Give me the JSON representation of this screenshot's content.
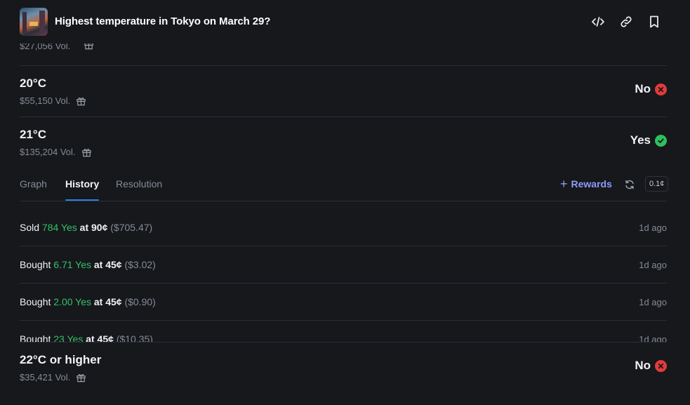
{
  "header": {
    "title": "Highest temperature in Tokyo on March 29?",
    "icons": [
      "code-icon",
      "link-icon",
      "bookmark-icon"
    ]
  },
  "partial_row": {
    "volume": "$27,056 Vol."
  },
  "outcomes": [
    {
      "label": "20°C",
      "volume": "$55,150 Vol.",
      "result": "No"
    },
    {
      "label": "21°C",
      "volume": "$135,204 Vol.",
      "result": "Yes"
    }
  ],
  "tabs": {
    "items": [
      {
        "label": "Graph"
      },
      {
        "label": "History"
      },
      {
        "label": "Resolution"
      }
    ],
    "active": "History",
    "rewards_label": "Rewards",
    "tick_size": "0.1¢"
  },
  "history": [
    {
      "action": "Sold",
      "amount": "784 Yes",
      "price": "at 90¢",
      "total": "($705.47)",
      "time": "1d ago"
    },
    {
      "action": "Bought",
      "amount": "6.71 Yes",
      "price": "at 45¢",
      "total": "($3.02)",
      "time": "1d ago"
    },
    {
      "action": "Bought",
      "amount": "2.00 Yes",
      "price": "at 45¢",
      "total": "($0.90)",
      "time": "1d ago"
    },
    {
      "action": "Bought",
      "amount": "23 Yes",
      "price": "at 45¢",
      "total": "($10.35)",
      "time": "1d ago"
    }
  ],
  "bottom_outcome": {
    "label": "22°C or higher",
    "volume": "$35,421 Vol.",
    "result": "No"
  },
  "colors": {
    "yes": "#2fbf5e",
    "no": "#e23b3b",
    "accent": "#2f7fe6",
    "rewards": "#8d9cf8"
  }
}
